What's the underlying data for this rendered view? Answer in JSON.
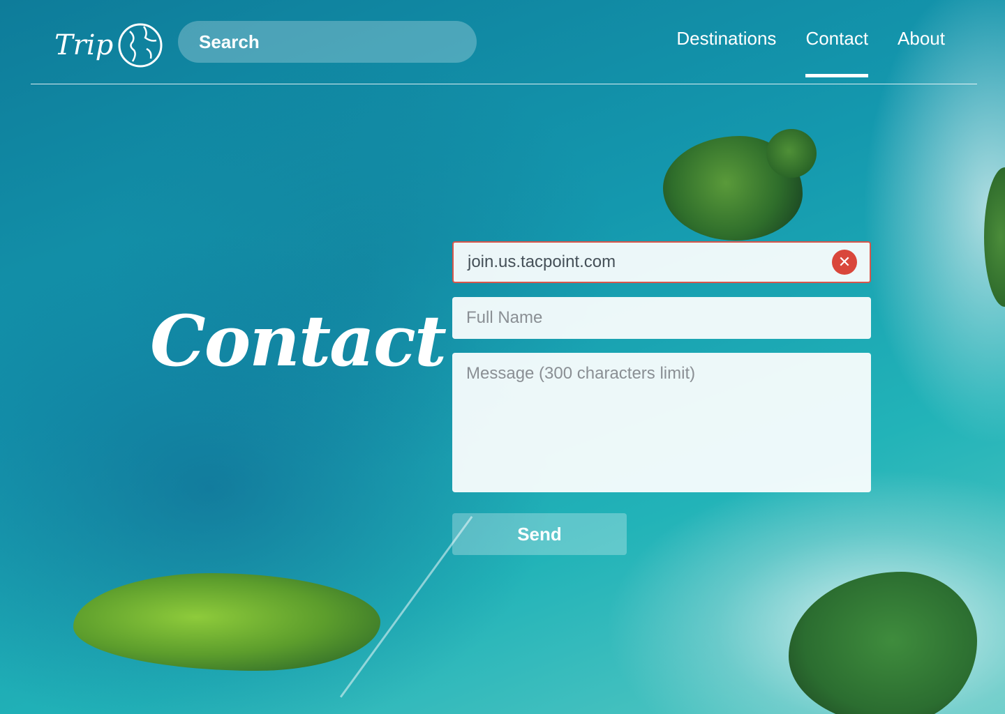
{
  "header": {
    "logo_text": "Trip",
    "search_placeholder": "Search",
    "nav": [
      "Destinations",
      "Contact",
      "About"
    ],
    "active_nav": "Contact"
  },
  "page": {
    "title": "Contact"
  },
  "form": {
    "url_value": "join.us.tacpoint.com",
    "name_placeholder": "Full Name",
    "message_placeholder": "Message (300 characters limit)",
    "send_label": "Send"
  },
  "colors": {
    "error": "#d9473b",
    "text_muted": "#8a8f94"
  }
}
